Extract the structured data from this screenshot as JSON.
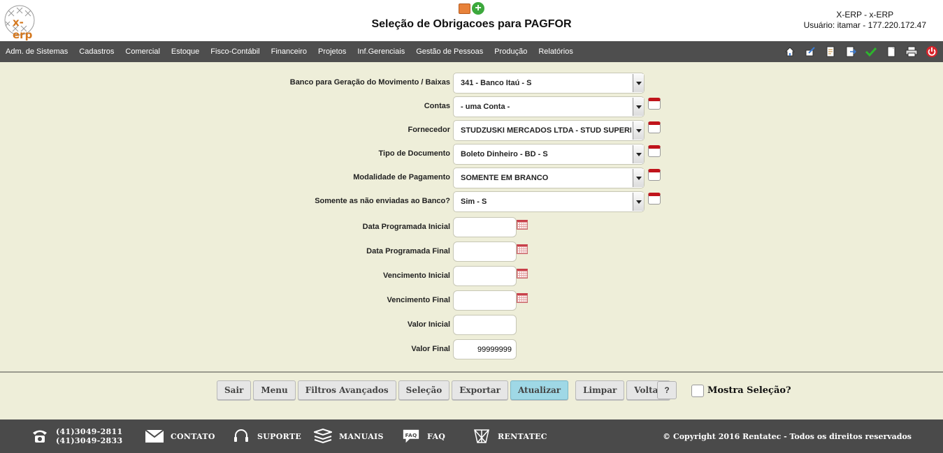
{
  "header": {
    "logo_text": "x-erp",
    "title": "Seleção de Obrigacoes para PAGFOR",
    "system": "X-ERP - x-ERP",
    "user": "Usuário: itamar - 177.220.172.47"
  },
  "nav": {
    "items": [
      "Adm. de Sistemas",
      "Cadastros",
      "Comercial",
      "Estoque",
      "Fisco-Contábil",
      "Financeiro",
      "Projetos",
      "Inf.Gerenciais",
      "Gestão de Pessoas",
      "Produção",
      "Relatórios"
    ],
    "tools": [
      "home-icon",
      "edit-icon",
      "document-edit-icon",
      "export-icon",
      "check-icon",
      "copy-icon",
      "print-icon",
      "power-icon"
    ]
  },
  "form": {
    "banco": {
      "label": "Banco para Geração do Movimento / Baixas",
      "value": "341 - Banco Itaú - S"
    },
    "contas": {
      "label": "Contas",
      "value": "- uma Conta -"
    },
    "fornecedor": {
      "label": "Fornecedor",
      "value": "STUDZUSKI MERCADOS LTDA - STUD SUPERMERCADO"
    },
    "tipo_documento": {
      "label": "Tipo de Documento",
      "value": "Boleto Dinheiro - BD - S"
    },
    "modalidade": {
      "label": "Modalidade de Pagamento",
      "value": "SOMENTE EM BRANCO"
    },
    "somente": {
      "label": "Somente as não enviadas ao Banco?",
      "value": "Sim - S"
    },
    "data_prog_inicial": {
      "label": "Data Programada Inicial",
      "value": ""
    },
    "data_prog_final": {
      "label": "Data Programada Final",
      "value": ""
    },
    "venc_inicial": {
      "label": "Vencimento Inicial",
      "value": ""
    },
    "venc_final": {
      "label": "Vencimento Final",
      "value": ""
    },
    "valor_inicial": {
      "label": "Valor Inicial",
      "value": ""
    },
    "valor_final": {
      "label": "Valor Final",
      "value": "99999999"
    }
  },
  "buttons": {
    "sair": "Sair",
    "menu": "Menu",
    "filtros": "Filtros Avançados",
    "selecao": "Seleção",
    "exportar": "Exportar",
    "atualizar": "Atualizar",
    "limpar": "Limpar",
    "voltar": "Voltar",
    "help": "?",
    "mostra_selecao": "Mostra Seleção?"
  },
  "footer": {
    "phone1": "(41)3049-2811",
    "phone2": "(41)3049-2833",
    "contato": "CONTATO",
    "suporte": "SUPORTE",
    "manuais": "MANUAIS",
    "faq": "FAQ",
    "faq_icon_text": "FAQ",
    "rentatec": "RENTATEC",
    "copyright": "© Copyright 2016 Rentatec - Todos os direitos reservados"
  },
  "colors": {
    "background": "#eeeed9",
    "nav_bg": "#4e4e4e",
    "footer_bg": "#4a4a4a",
    "primary_button": "#9fd8e6",
    "logo": "#d4781f"
  }
}
